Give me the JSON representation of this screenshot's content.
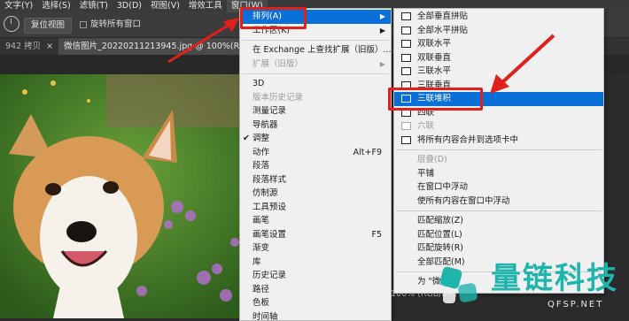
{
  "menubar": {
    "items": [
      "文字(Y)",
      "选择(S)",
      "滤镜(T)",
      "3D(D)",
      "视图(V)",
      "增效工具",
      "窗口(W)"
    ]
  },
  "options": {
    "reset_label": "复位视图",
    "rotate_all_label": "旋转所有窗口"
  },
  "tabs": [
    {
      "label": "942 拷贝"
    },
    {
      "label": "微信图片_20220211213945.jpg @ 100%(RGB/8#)"
    }
  ],
  "window_menu": {
    "items": [
      {
        "label": "排列(A)",
        "type": "submenu",
        "highlighted": true
      },
      {
        "label": "工作区(K)",
        "type": "submenu"
      },
      {
        "type": "separator"
      },
      {
        "label": "在 Exchange 上查找扩展（旧版）..."
      },
      {
        "label": "扩展（旧版）",
        "type": "submenu",
        "disabled": true
      },
      {
        "type": "separator"
      },
      {
        "label": "3D"
      },
      {
        "label": "版本历史记录",
        "disabled": true
      },
      {
        "label": "测量记录"
      },
      {
        "label": "导航器"
      },
      {
        "label": "调整",
        "checked": true
      },
      {
        "label": "动作",
        "shortcut": "Alt+F9"
      },
      {
        "label": "段落"
      },
      {
        "label": "段落样式"
      },
      {
        "label": "仿制源"
      },
      {
        "label": "工具预设"
      },
      {
        "label": "画笔"
      },
      {
        "label": "画笔设置",
        "shortcut": "F5"
      },
      {
        "label": "渐变"
      },
      {
        "label": "库"
      },
      {
        "label": "历史记录"
      },
      {
        "label": "路径"
      },
      {
        "label": "色板"
      },
      {
        "label": "时间轴"
      }
    ]
  },
  "arrange_menu": {
    "items": [
      {
        "label": "全部垂直拼贴",
        "icon": "tile-vertical-icon"
      },
      {
        "label": "全部水平拼贴",
        "icon": "tile-horizontal-icon"
      },
      {
        "label": "双联水平",
        "icon": "two-up-horizontal-icon"
      },
      {
        "label": "双联垂直",
        "icon": "two-up-vertical-icon"
      },
      {
        "label": "三联水平",
        "icon": "three-up-horizontal-icon"
      },
      {
        "label": "三联垂直",
        "icon": "three-up-vertical-icon"
      },
      {
        "label": "三联堆积",
        "icon": "three-up-stacked-icon",
        "highlighted": true
      },
      {
        "label": "四联",
        "icon": "four-up-icon"
      },
      {
        "label": "六联",
        "icon": "six-up-icon",
        "disabled": true
      },
      {
        "label": "将所有内容合并到选项卡中",
        "icon": "consolidate-tabs-icon"
      },
      {
        "type": "separator"
      },
      {
        "label": "层叠(D)",
        "disabled": true
      },
      {
        "label": "平铺"
      },
      {
        "label": "在窗口中浮动"
      },
      {
        "label": "使所有内容在窗口中浮动"
      },
      {
        "type": "separator"
      },
      {
        "label": "匹配缩放(Z)"
      },
      {
        "label": "匹配位置(L)"
      },
      {
        "label": "匹配旋转(R)"
      },
      {
        "label": "全部匹配(M)"
      },
      {
        "type": "separator"
      },
      {
        "label": "为 \"微"
      }
    ]
  },
  "status": {
    "zoom_text": "# 100% (RGB/8#)"
  },
  "watermark": {
    "brand": "量链科技",
    "site": "QFSP.NET"
  },
  "colors": {
    "highlight": "#0a6fd6",
    "annotation_red": "#e0201a",
    "brand_teal": "#1fb5ad"
  }
}
